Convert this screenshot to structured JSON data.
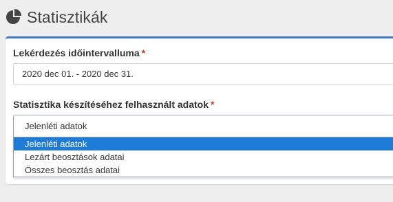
{
  "header": {
    "title": "Statisztikák",
    "icon": "pie-chart-icon"
  },
  "form": {
    "date_range": {
      "label": "Lekérdezés időintervalluma",
      "required_mark": "*",
      "value": "2020 dec 01. - 2020 dec 31."
    },
    "data_source": {
      "label": "Statisztika készítéséhez felhasznált adatok",
      "required_mark": "*",
      "value": "Jelenléti adatok",
      "options": [
        {
          "label": "Jelenléti adatok",
          "highlighted": true
        },
        {
          "label": "Lezárt beosztások adatai",
          "highlighted": false
        },
        {
          "label": "Összes beosztás adatai",
          "highlighted": false
        }
      ]
    }
  },
  "colors": {
    "accent": "#3c78c2",
    "highlight": "#1e7bd6",
    "required": "#c0392b"
  }
}
